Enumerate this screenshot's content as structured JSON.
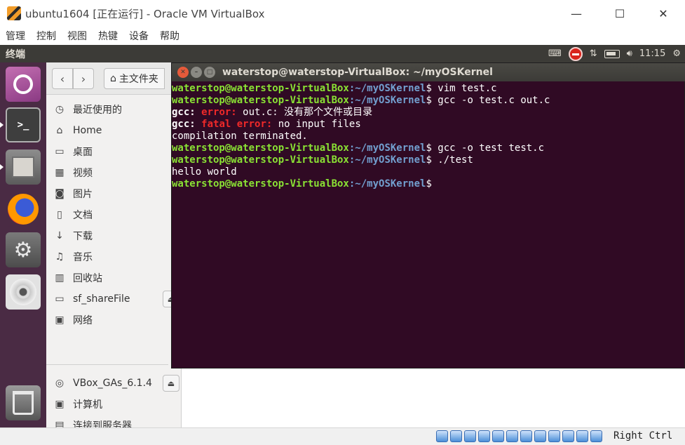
{
  "host_window": {
    "title": "ubuntu1604 [正在运行] - Oracle VM VirtualBox",
    "minimize": "—",
    "maximize": "☐",
    "close": "✕"
  },
  "host_menu": [
    "管理",
    "控制",
    "视图",
    "热键",
    "设备",
    "帮助"
  ],
  "ubuntu_panel": {
    "title": "终端",
    "time": "11:15",
    "indicators": [
      "keyboard-icon",
      "record-icon",
      "network-arrows-icon",
      "battery-icon",
      "volume-icon",
      "gear-icon"
    ]
  },
  "launcher": {
    "items": [
      "ubuntu-dash-icon",
      "terminal-icon",
      "files-icon",
      "firefox-icon",
      "settings-icon",
      "dvd-icon",
      "trash-icon"
    ],
    "terminal_prompt": ">_"
  },
  "files": {
    "toolbar": {
      "back": "‹",
      "forward": "›",
      "home_label": "主文件夹"
    },
    "sidebar": [
      {
        "icon": "clock-icon",
        "glyph": "◷",
        "label": "最近使用的"
      },
      {
        "icon": "home-icon",
        "glyph": "⌂",
        "label": "Home"
      },
      {
        "icon": "folder-icon",
        "glyph": "▭",
        "label": "桌面"
      },
      {
        "icon": "video-icon",
        "glyph": "▦",
        "label": "视频"
      },
      {
        "icon": "camera-icon",
        "glyph": "◙",
        "label": "图片"
      },
      {
        "icon": "document-icon",
        "glyph": "▯",
        "label": "文档"
      },
      {
        "icon": "download-icon",
        "glyph": "↓",
        "label": "下载"
      },
      {
        "icon": "music-icon",
        "glyph": "♫",
        "label": "音乐"
      },
      {
        "icon": "trash-icon",
        "glyph": "▥",
        "label": "回收站"
      },
      {
        "icon": "folder-icon",
        "glyph": "▭",
        "label": "sf_shareFile",
        "eject": true
      },
      {
        "icon": "network-icon",
        "glyph": "▣",
        "label": "网络"
      },
      {
        "icon": "disc-icon",
        "glyph": "◎",
        "label": "VBox_GAs_6.1.4",
        "eject": true
      },
      {
        "icon": "computer-icon",
        "glyph": "▣",
        "label": "计算机"
      },
      {
        "icon": "server-icon",
        "glyph": "▤",
        "label": "连接到服务器"
      }
    ],
    "eject_glyph": "⏏"
  },
  "terminal": {
    "title": "waterstop@waterstop-VirtualBox: ~/myOSKernel",
    "close": "✕",
    "minimize": "–",
    "maximize": "□",
    "user_host": "waterstop@waterstop-VirtualBox",
    "path": ":~/myOSKernel",
    "lines": [
      {
        "type": "prompt",
        "cmd": "$ vim test.c"
      },
      {
        "type": "prompt",
        "cmd": "$ gcc -o test.c out.c"
      },
      {
        "type": "error",
        "prefix": "gcc:",
        "label": "error:",
        "msg": " out.c: 没有那个文件或目录"
      },
      {
        "type": "error",
        "prefix": "gcc:",
        "label": "fatal error:",
        "msg": " no input files"
      },
      {
        "type": "plain",
        "text": "compilation terminated."
      },
      {
        "type": "prompt",
        "cmd": "$ gcc -o test test.c"
      },
      {
        "type": "prompt",
        "cmd": "$ ./test"
      },
      {
        "type": "plain",
        "text": "hello world"
      },
      {
        "type": "prompt",
        "cmd": "$"
      }
    ]
  },
  "statusbar": {
    "icons": [
      "hard-disk-icon",
      "optical-drive-icon",
      "audio-icon",
      "network-icon",
      "usb-icon",
      "shared-folder-icon",
      "display-icon",
      "recording-icon",
      "cpu-icon",
      "virtualization-icon",
      "mouse-integration-icon",
      "keyboard-capture-icon"
    ],
    "host_key": "Right Ctrl"
  }
}
